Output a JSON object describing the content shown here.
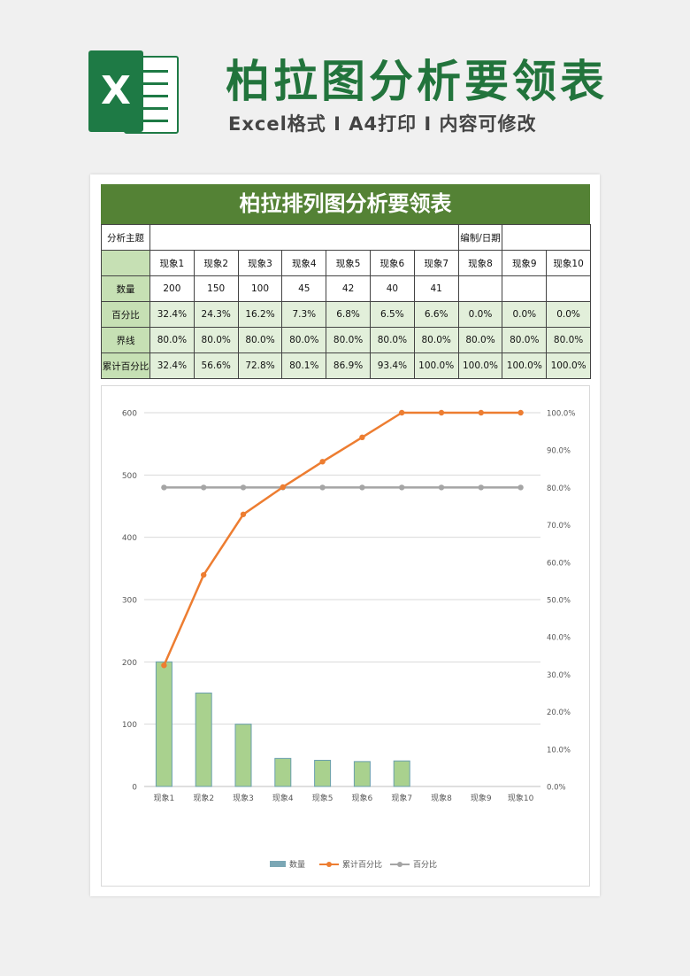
{
  "banner": {
    "logo_letter": "X",
    "title": "柏拉图分析要领表",
    "subtitle": "Excel格式 I A4打印 I 内容可修改"
  },
  "sheet": {
    "title": "柏拉排列图分析要领表",
    "subject_label": "分析主题",
    "subject_value": "",
    "editor_label": "编制/日期",
    "editor_value": "",
    "phenomena": [
      "现象1",
      "现象2",
      "现象3",
      "现象4",
      "现象5",
      "现象6",
      "现象7",
      "现象8",
      "现象9",
      "现象10"
    ],
    "rows": [
      {
        "label": "数量",
        "values": [
          "200",
          "150",
          "100",
          "45",
          "42",
          "40",
          "41",
          "",
          "",
          ""
        ]
      },
      {
        "label": "百分比",
        "values": [
          "32.4%",
          "24.3%",
          "16.2%",
          "7.3%",
          "6.8%",
          "6.5%",
          "6.6%",
          "0.0%",
          "0.0%",
          "0.0%"
        ]
      },
      {
        "label": "界线",
        "values": [
          "80.0%",
          "80.0%",
          "80.0%",
          "80.0%",
          "80.0%",
          "80.0%",
          "80.0%",
          "80.0%",
          "80.0%",
          "80.0%"
        ]
      },
      {
        "label": "累计百分比",
        "values": [
          "32.4%",
          "56.6%",
          "72.8%",
          "80.1%",
          "86.9%",
          "93.4%",
          "100.0%",
          "100.0%",
          "100.0%",
          "100.0%"
        ]
      }
    ]
  },
  "chart_data": {
    "type": "bar",
    "categories": [
      "现象1",
      "现象2",
      "现象3",
      "现象4",
      "现象5",
      "现象6",
      "现象7",
      "现象8",
      "现象9",
      "现象10"
    ],
    "series": [
      {
        "name": "数量",
        "type": "bar",
        "axis": "left",
        "color": "#a9d18e",
        "values": [
          200,
          150,
          100,
          45,
          42,
          40,
          41,
          null,
          null,
          null
        ]
      },
      {
        "name": "累计百分比",
        "type": "line",
        "axis": "right",
        "color": "#ed7d31",
        "values": [
          32.4,
          56.6,
          72.8,
          80.1,
          86.9,
          93.4,
          100.0,
          100.0,
          100.0,
          100.0
        ]
      },
      {
        "name": "百分比",
        "type": "line",
        "axis": "right",
        "color": "#a5a5a5",
        "values": [
          80,
          80,
          80,
          80,
          80,
          80,
          80,
          80,
          80,
          80
        ]
      }
    ],
    "y_left": {
      "min": 0,
      "max": 600,
      "ticks": [
        "0",
        "100",
        "200",
        "300",
        "400",
        "500",
        "600"
      ]
    },
    "y_right": {
      "min": 0,
      "max": 100,
      "ticks": [
        "0.0%",
        "10.0%",
        "20.0%",
        "30.0%",
        "40.0%",
        "50.0%",
        "60.0%",
        "70.0%",
        "80.0%",
        "90.0%",
        "100.0%"
      ]
    },
    "grid": true,
    "legend_position": "bottom"
  }
}
